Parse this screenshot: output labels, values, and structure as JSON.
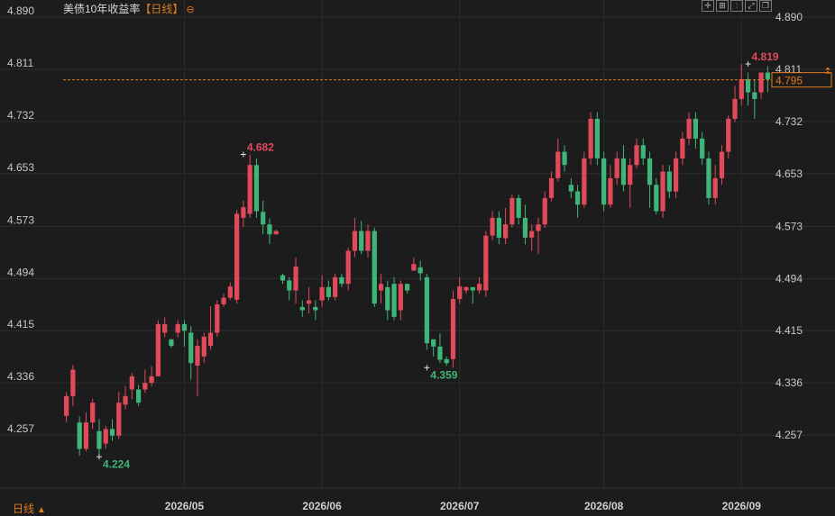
{
  "header": {
    "title": "美债10年收益率",
    "period": "【日线】",
    "collapse_icon": "circle-minus-icon"
  },
  "toolbar": {
    "icons": [
      "crosshair-icon",
      "grid-icon",
      "bar-chart-icon",
      "expand-icon",
      "window-icon"
    ]
  },
  "footer": {
    "period_label": "日线",
    "period_icon": "triangle-up-icon"
  },
  "colors": {
    "up": "#e04a5a",
    "down": "#3fb57a",
    "grid": "#2c2c2c",
    "last_line": "#e07b1f",
    "axis_text": "#c8c8c8"
  },
  "chart_data": {
    "type": "candlestick",
    "title": "美债10年收益率",
    "y_ticks": [
      "4.890",
      "4.811",
      "4.732",
      "4.653",
      "4.573",
      "4.494",
      "4.415",
      "4.336",
      "4.257"
    ],
    "ylim": [
      4.178,
      4.89
    ],
    "x_ticks": [
      {
        "label": "2026/05",
        "index": 18
      },
      {
        "label": "2026/06",
        "index": 39
      },
      {
        "label": "2026/07",
        "index": 60
      },
      {
        "label": "2026/08",
        "index": 82
      },
      {
        "label": "2026/09",
        "index": 103
      }
    ],
    "last_value": "4.795",
    "annotations": [
      {
        "text": "4.682",
        "index": 27,
        "value": 4.682,
        "kind": "high"
      },
      {
        "text": "4.224",
        "index": 5,
        "value": 4.224,
        "kind": "low"
      },
      {
        "text": "4.359",
        "index": 55,
        "value": 4.359,
        "kind": "low"
      },
      {
        "text": "4.819",
        "index": 104,
        "value": 4.819,
        "kind": "high"
      }
    ],
    "candles": [
      [
        4.286,
        4.316,
        4.276,
        4.322
      ],
      [
        4.316,
        4.356,
        4.301,
        4.363
      ],
      [
        4.276,
        4.236,
        4.226,
        4.285
      ],
      [
        4.236,
        4.276,
        4.232,
        4.291
      ],
      [
        4.276,
        4.306,
        4.266,
        4.312
      ],
      [
        4.263,
        4.236,
        4.224,
        4.281
      ],
      [
        4.244,
        4.266,
        4.236,
        4.271
      ],
      [
        4.266,
        4.256,
        4.248,
        4.281
      ],
      [
        4.256,
        4.306,
        4.251,
        4.322
      ],
      [
        4.303,
        4.316,
        4.296,
        4.331
      ],
      [
        4.326,
        4.346,
        4.311,
        4.351
      ],
      [
        4.326,
        4.306,
        4.301,
        4.333
      ],
      [
        4.326,
        4.336,
        4.321,
        4.356
      ],
      [
        4.336,
        4.346,
        4.331,
        4.361
      ],
      [
        4.346,
        4.425,
        4.346,
        4.431
      ],
      [
        4.412,
        4.425,
        4.405,
        4.435
      ],
      [
        4.402,
        4.392,
        4.389,
        4.402
      ],
      [
        4.412,
        4.425,
        4.405,
        4.431
      ],
      [
        4.425,
        4.415,
        4.391,
        4.431
      ],
      [
        4.412,
        4.366,
        4.341,
        4.422
      ],
      [
        4.362,
        4.392,
        4.316,
        4.402
      ],
      [
        4.376,
        4.406,
        4.366,
        4.412
      ],
      [
        4.392,
        4.412,
        4.386,
        4.452
      ],
      [
        4.412,
        4.455,
        4.406,
        4.461
      ],
      [
        4.455,
        4.465,
        4.451,
        4.471
      ],
      [
        4.465,
        4.482,
        4.462,
        4.488
      ],
      [
        4.462,
        4.592,
        4.456,
        4.598
      ],
      [
        4.586,
        4.602,
        4.572,
        4.612
      ],
      [
        4.592,
        4.666,
        4.586,
        4.682
      ],
      [
        4.666,
        4.596,
        4.586,
        4.676
      ],
      [
        4.595,
        4.576,
        4.561,
        4.612
      ],
      [
        4.576,
        4.561,
        4.546,
        4.585
      ],
      [
        4.561,
        4.566,
        4.561,
        4.568
      ],
      [
        4.499,
        4.491,
        4.486,
        4.501
      ],
      [
        4.491,
        4.476,
        4.461,
        4.496
      ],
      [
        4.476,
        4.512,
        4.456,
        4.526
      ],
      [
        4.451,
        4.446,
        4.436,
        4.461
      ],
      [
        4.456,
        4.461,
        4.441,
        4.481
      ],
      [
        4.451,
        4.446,
        4.431,
        4.461
      ],
      [
        4.461,
        4.481,
        4.451,
        4.499
      ],
      [
        4.481,
        4.466,
        4.461,
        4.491
      ],
      [
        4.466,
        4.496,
        4.461,
        4.501
      ],
      [
        4.496,
        4.486,
        4.481,
        4.501
      ],
      [
        4.486,
        4.536,
        4.476,
        4.541
      ],
      [
        4.536,
        4.566,
        4.526,
        4.586
      ],
      [
        4.566,
        4.536,
        4.531,
        4.581
      ],
      [
        4.536,
        4.566,
        4.526,
        4.576
      ],
      [
        4.566,
        4.456,
        4.451,
        4.571
      ],
      [
        4.476,
        4.486,
        4.456,
        4.501
      ],
      [
        4.481,
        4.446,
        4.431,
        4.491
      ],
      [
        4.486,
        4.436,
        4.431,
        4.496
      ],
      [
        4.446,
        4.486,
        4.431,
        4.491
      ],
      [
        4.486,
        4.476,
        4.471,
        4.486
      ],
      [
        4.506,
        4.516,
        4.506,
        4.526
      ],
      [
        4.511,
        4.502,
        4.491,
        4.521
      ],
      [
        4.496,
        4.396,
        4.386,
        4.501
      ],
      [
        4.402,
        4.391,
        4.376,
        4.401
      ],
      [
        4.391,
        4.371,
        4.366,
        4.411
      ],
      [
        4.372,
        4.366,
        4.362,
        4.376
      ],
      [
        4.372,
        4.463,
        4.359,
        4.476
      ],
      [
        4.463,
        4.482,
        4.456,
        4.496
      ],
      [
        4.476,
        4.481,
        4.471,
        4.482
      ],
      [
        4.481,
        4.476,
        4.456,
        4.481
      ],
      [
        4.476,
        4.486,
        4.471,
        4.496
      ],
      [
        4.476,
        4.559,
        4.466,
        4.566
      ],
      [
        4.559,
        4.586,
        4.552,
        4.596
      ],
      [
        4.586,
        4.556,
        4.546,
        4.596
      ],
      [
        4.555,
        4.576,
        4.546,
        4.601
      ],
      [
        4.576,
        4.616,
        4.571,
        4.621
      ],
      [
        4.616,
        4.586,
        4.576,
        4.621
      ],
      [
        4.586,
        4.556,
        4.546,
        4.606
      ],
      [
        4.556,
        4.566,
        4.536,
        4.576
      ],
      [
        4.566,
        4.576,
        4.531,
        4.586
      ],
      [
        4.576,
        4.616,
        4.571,
        4.626
      ],
      [
        4.616,
        4.646,
        4.611,
        4.656
      ],
      [
        4.646,
        4.686,
        4.641,
        4.706
      ],
      [
        4.686,
        4.666,
        4.656,
        4.696
      ],
      [
        4.636,
        4.626,
        4.616,
        4.646
      ],
      [
        4.626,
        4.606,
        4.586,
        4.636
      ],
      [
        4.606,
        4.676,
        4.601,
        4.686
      ],
      [
        4.676,
        4.736,
        4.666,
        4.746
      ],
      [
        4.736,
        4.676,
        4.666,
        4.746
      ],
      [
        4.676,
        4.606,
        4.596,
        4.686
      ],
      [
        4.606,
        4.646,
        4.601,
        4.666
      ],
      [
        4.646,
        4.676,
        4.636,
        4.686
      ],
      [
        4.676,
        4.636,
        4.626,
        4.696
      ],
      [
        4.636,
        4.666,
        4.601,
        4.676
      ],
      [
        4.666,
        4.696,
        4.661,
        4.706
      ],
      [
        4.696,
        4.676,
        4.666,
        4.706
      ],
      [
        4.676,
        4.636,
        4.601,
        4.686
      ],
      [
        4.636,
        4.596,
        4.591,
        4.646
      ],
      [
        4.596,
        4.656,
        4.586,
        4.666
      ],
      [
        4.656,
        4.626,
        4.616,
        4.666
      ],
      [
        4.626,
        4.676,
        4.616,
        4.686
      ],
      [
        4.676,
        4.706,
        4.666,
        4.716
      ],
      [
        4.706,
        4.736,
        4.696,
        4.746
      ],
      [
        4.736,
        4.706,
        4.691,
        4.746
      ],
      [
        4.706,
        4.676,
        4.666,
        4.716
      ],
      [
        4.676,
        4.616,
        4.606,
        4.686
      ],
      [
        4.616,
        4.646,
        4.606,
        4.666
      ],
      [
        4.646,
        4.686,
        4.636,
        4.696
      ],
      [
        4.686,
        4.736,
        4.676,
        4.741
      ],
      [
        4.736,
        4.766,
        4.731,
        4.786
      ],
      [
        4.766,
        4.796,
        4.756,
        4.819
      ],
      [
        4.796,
        4.776,
        4.756,
        4.806
      ],
      [
        4.776,
        4.766,
        4.736,
        4.796
      ],
      [
        4.776,
        4.806,
        4.766,
        4.806
      ],
      [
        4.806,
        4.796,
        4.776,
        4.816
      ]
    ]
  }
}
